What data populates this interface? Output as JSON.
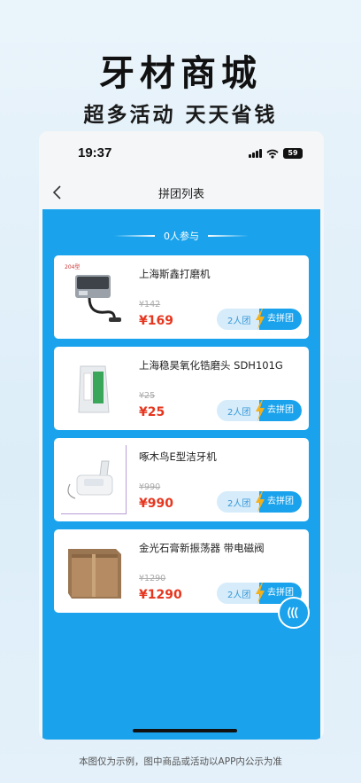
{
  "promo": {
    "title": "牙材商城",
    "subtitle": "超多活动  天天省钱",
    "disclaimer": "本图仅为示例，图中商品或活动以APP内公示为准"
  },
  "status_bar": {
    "time": "19:37",
    "battery": "59"
  },
  "nav": {
    "title": "拼团列表",
    "back_icon": "chevron-left-icon"
  },
  "participants_label": "0人参与",
  "colors": {
    "accent": "#1aa3ec",
    "price": "#e6361f",
    "bolt": "#f5b01a"
  },
  "products": [
    {
      "name": "上海斯鑫打磨机",
      "original_price": "¥142",
      "price": "¥169",
      "group_size": "2人团",
      "join_label": "去拼团",
      "thumb_label": "204型"
    },
    {
      "name": "上海稳昊氧化锆磨头 SDH101G",
      "original_price": "¥25",
      "price": "¥25",
      "group_size": "2人团",
      "join_label": "去拼团"
    },
    {
      "name": "啄木鸟E型洁牙机",
      "original_price": "¥990",
      "price": "¥990",
      "group_size": "2人团",
      "join_label": "去拼团"
    },
    {
      "name": "金光石膏新振荡器 带电磁阀",
      "original_price": "¥1290",
      "price": "¥1290",
      "group_size": "2人团",
      "join_label": "去拼团"
    }
  ]
}
